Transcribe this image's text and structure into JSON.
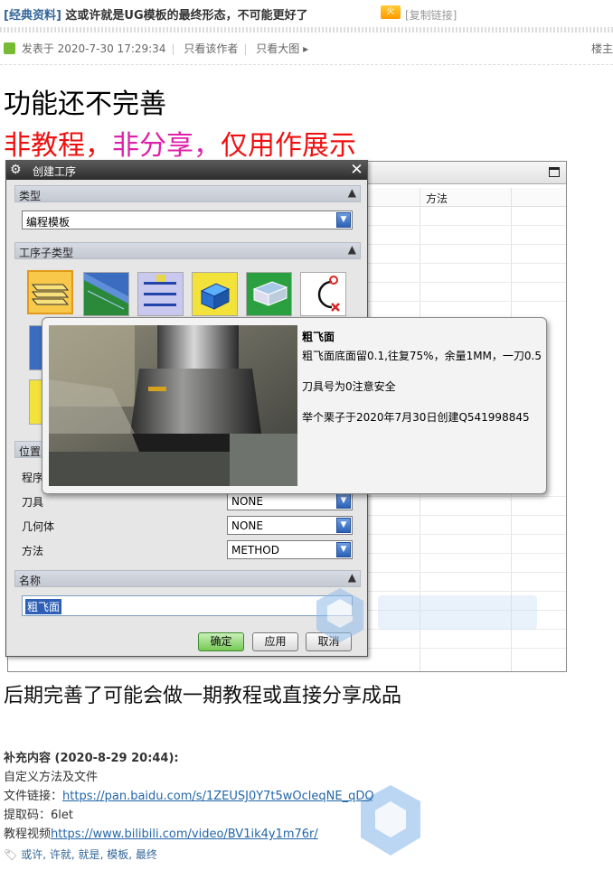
{
  "thread": {
    "category": "[经典资料]",
    "title": "这或许就是UG模板的最终形态，不可能更好了",
    "badge": "火",
    "copy_link": "[复制链接]"
  },
  "post_meta": {
    "posted": "发表于 2020-7-30 17:29:34",
    "author_only": "只看该作者",
    "big_image": "只看大图",
    "arrow": "▸",
    "floor": "楼主"
  },
  "headline": "功能还不完善",
  "subheadline": {
    "part1": "非教程，",
    "part2": "非分享，",
    "part3": "仅用作展示"
  },
  "background_window": {
    "column_method": "方法"
  },
  "dialog": {
    "title": "创建工序",
    "sections": {
      "type": "类型",
      "subtype": "工序子类型",
      "location": "位置",
      "name": "名称"
    },
    "type_value": "编程模板",
    "location_rows": [
      {
        "label": "程序",
        "value": ""
      },
      {
        "label": "刀具",
        "value": "NONE"
      },
      {
        "label": "几何体",
        "value": "NONE"
      },
      {
        "label": "方法",
        "value": "METHOD"
      }
    ],
    "name_value": "粗飞面",
    "buttons": {
      "ok": "确定",
      "apply": "应用",
      "cancel": "取消"
    },
    "collapse_icon": "▲",
    "dropdown_icon": "▼"
  },
  "tooltip": {
    "title": "粗飞面",
    "line1": "粗飞面底面留0.1,往复75%，余量1MM，一刀0.5",
    "line2": "刀具号为0注意安全",
    "line3": "举个栗子于2020年7月30日创建Q541998845"
  },
  "post_body": {
    "followup": "后期完善了可能会做一期教程或直接分享成品",
    "supplement_head": "补充内容 (2020-8-29 20:44):",
    "line1": "自定义方法及文件",
    "file_label": "文件链接：",
    "file_url": "https://pan.baidu.com/s/1ZEUSJ0Y7t5wOcleqNE_qDQ",
    "code_label": "提取码：",
    "code_value": "6let",
    "video_label": "教程视频",
    "video_url": "https://www.bilibili.com/video/BV1ik4y1m76r/",
    "tags": [
      "或许",
      "许就",
      "就是",
      "模板",
      "最终"
    ]
  },
  "icons": {
    "gear": "gear-icon",
    "close": "close-icon",
    "tag": "tag-icon"
  },
  "colors": {
    "link": "#2366a8",
    "headline_red": "#ee1111",
    "headline_magenta": "#dd22aa",
    "selection": "#2c5fb5"
  }
}
